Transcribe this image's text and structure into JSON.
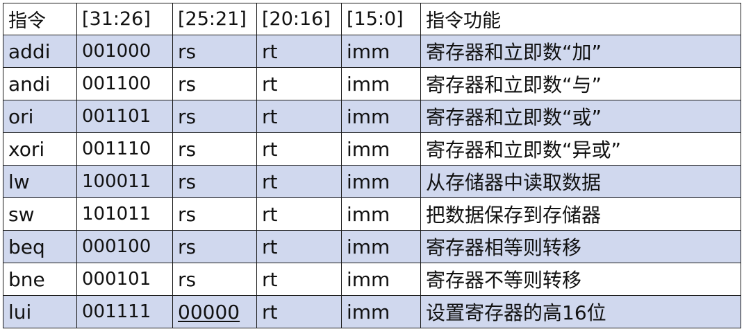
{
  "table": {
    "headers": [
      "指令",
      "[31:26]",
      "[25:21]",
      "[20:16]",
      "[15:0]",
      "指令功能"
    ],
    "rows": [
      {
        "name": "addi",
        "opcode": "001000",
        "f1": "rs",
        "f2": "rt",
        "f3": "imm",
        "desc": "寄存器和立即数“加”",
        "shaded": true
      },
      {
        "name": "andi",
        "opcode": "001100",
        "f1": "rs",
        "f2": "rt",
        "f3": "imm",
        "desc": "寄存器和立即数“与”",
        "shaded": false
      },
      {
        "name": "ori",
        "opcode": "001101",
        "f1": "rs",
        "f2": "rt",
        "f3": "imm",
        "desc": "寄存器和立即数“或”",
        "shaded": true
      },
      {
        "name": "xori",
        "opcode": "001110",
        "f1": "rs",
        "f2": "rt",
        "f3": "imm",
        "desc": "寄存器和立即数“异或”",
        "shaded": false
      },
      {
        "name": "lw",
        "opcode": "100011",
        "f1": "rs",
        "f2": "rt",
        "f3": "imm",
        "desc": "从存储器中读取数据",
        "shaded": true
      },
      {
        "name": "sw",
        "opcode": "101011",
        "f1": "rs",
        "f2": "rt",
        "f3": "imm",
        "desc": "把数据保存到存储器",
        "shaded": false
      },
      {
        "name": "beq",
        "opcode": "000100",
        "f1": "rs",
        "f2": "rt",
        "f3": "imm",
        "desc": "寄存器相等则转移",
        "shaded": true
      },
      {
        "name": "bne",
        "opcode": "000101",
        "f1": "rs",
        "f2": "rt",
        "f3": "imm",
        "desc": "寄存器不等则转移",
        "shaded": false
      },
      {
        "name": "lui",
        "opcode": "001111",
        "f1": "00000",
        "f2": "rt",
        "f3": "imm",
        "desc": "设置寄存器的高16位",
        "shaded": true,
        "f1_underlined": true
      }
    ]
  },
  "colors": {
    "shaded_row": "#d0d8ee",
    "plain_row": "#ffffff",
    "border": "#1a1a1a",
    "text": "#111111"
  }
}
